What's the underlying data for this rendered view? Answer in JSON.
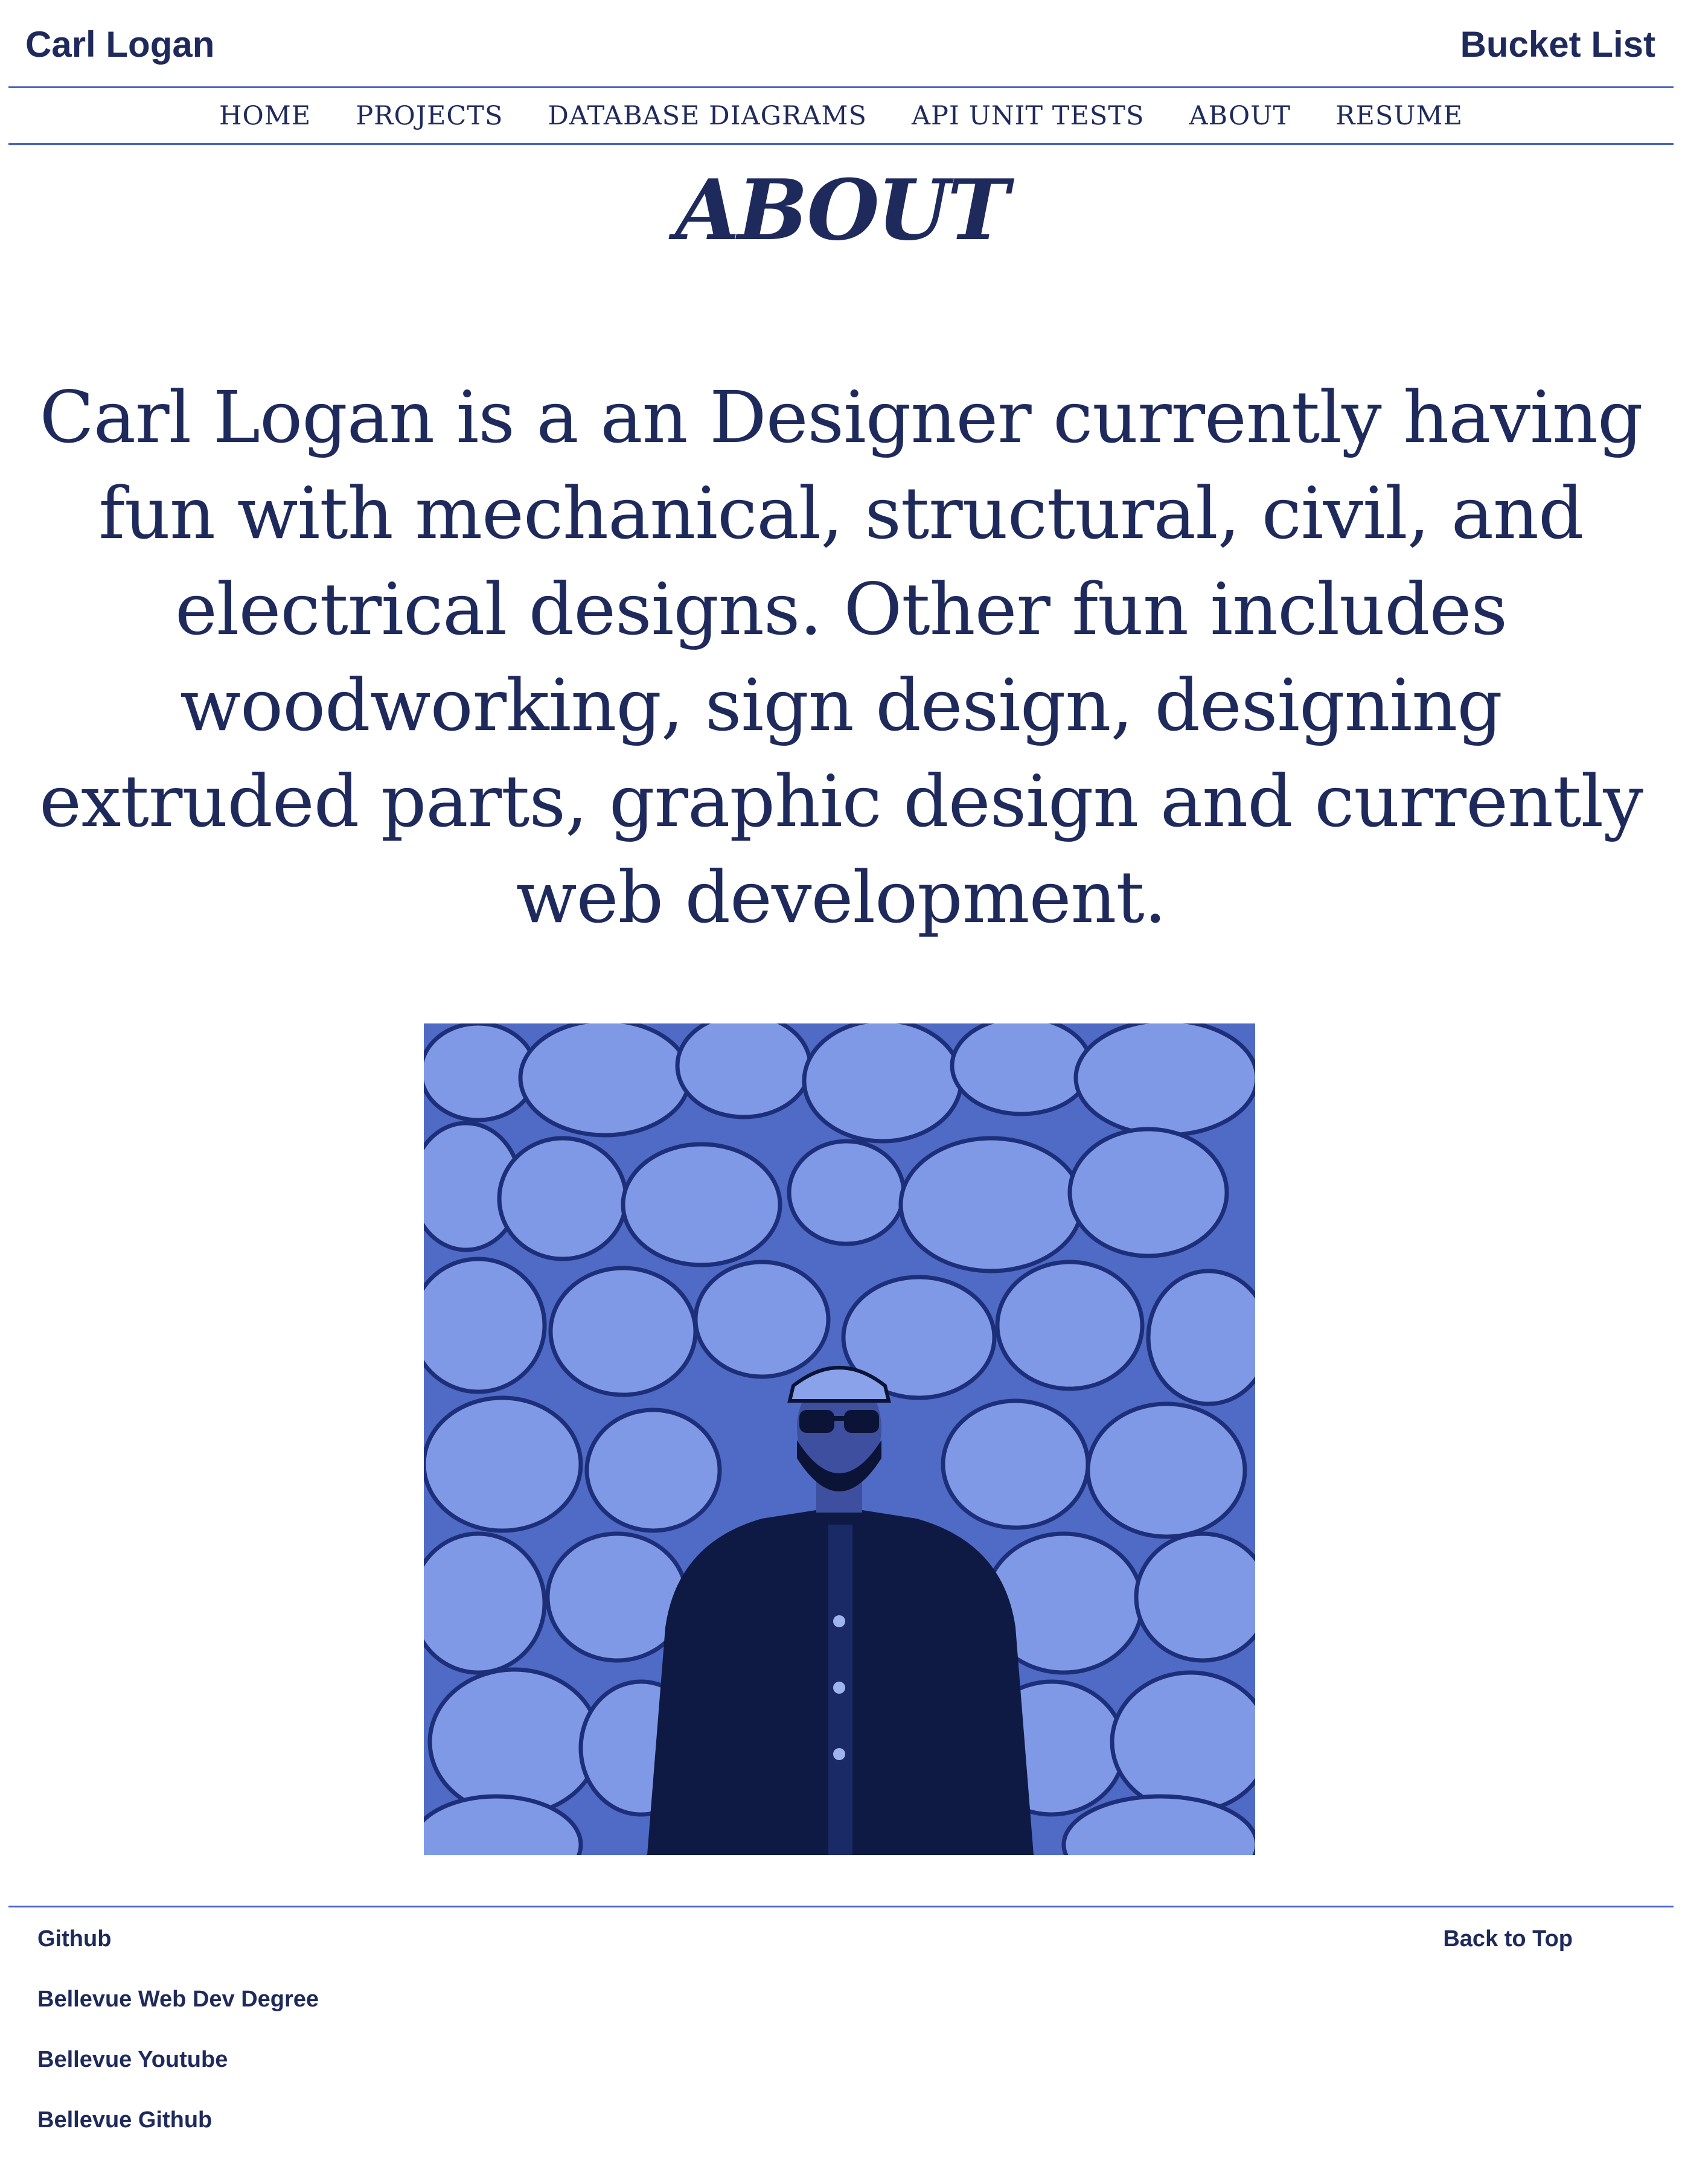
{
  "header": {
    "brand": "Carl Logan",
    "bucket_list": "Bucket List"
  },
  "nav": {
    "items": [
      {
        "label": "HOME"
      },
      {
        "label": "PROJECTS"
      },
      {
        "label": "DATABASE DIAGRAMS"
      },
      {
        "label": "API UNIT TESTS"
      },
      {
        "label": "ABOUT"
      },
      {
        "label": "RESUME"
      }
    ]
  },
  "main": {
    "title": "ABOUT",
    "bio": "Carl Logan is a an Designer currently having fun with mechanical, structural, civil, and electrical designs. Other fun includes woodworking, sign design, designing extruded parts, graphic design and currently web development."
  },
  "footer": {
    "links": [
      {
        "label": "Github"
      },
      {
        "label": "Bellevue Web Dev Degree"
      },
      {
        "label": "Bellevue Youtube"
      },
      {
        "label": "Bellevue Github"
      }
    ],
    "back_to_top": "Back to Top"
  },
  "colors": {
    "text": "#1f2a5c",
    "accent_rule": "#4a64c8",
    "photo_tint": "#5a76cf"
  }
}
